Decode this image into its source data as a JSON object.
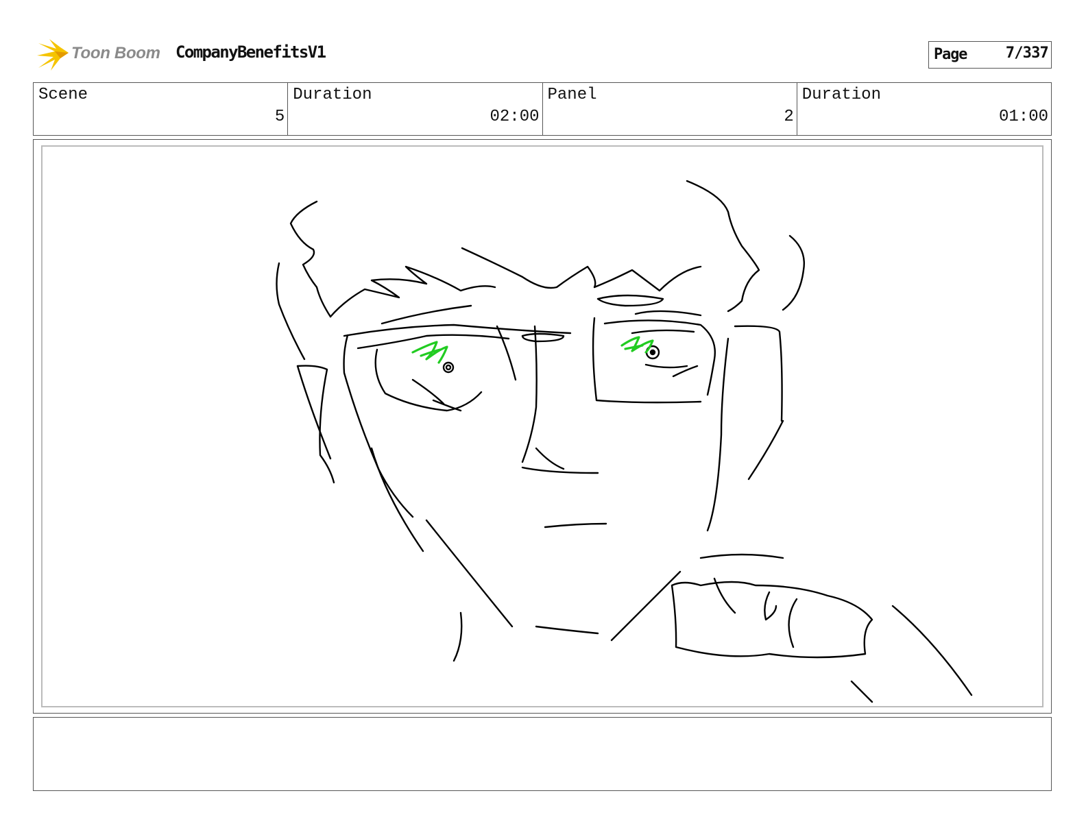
{
  "header": {
    "logo_text": "Toon Boom",
    "project_title": "CompanyBenefitsV1",
    "page_label": "Page",
    "page_value": "7/337"
  },
  "info": {
    "scene_label": "Scene",
    "scene_value": "5",
    "scene_duration_label": "Duration",
    "scene_duration_value": "02:00",
    "panel_label": "Panel",
    "panel_value": "2",
    "panel_duration_label": "Duration",
    "panel_duration_value": "01:00"
  },
  "colors": {
    "sketch_line": "#000000",
    "eye_highlight": "#22cc22",
    "logo_yellow": "#f5c400",
    "frame_border": "#555555"
  },
  "notes": {
    "text": ""
  }
}
